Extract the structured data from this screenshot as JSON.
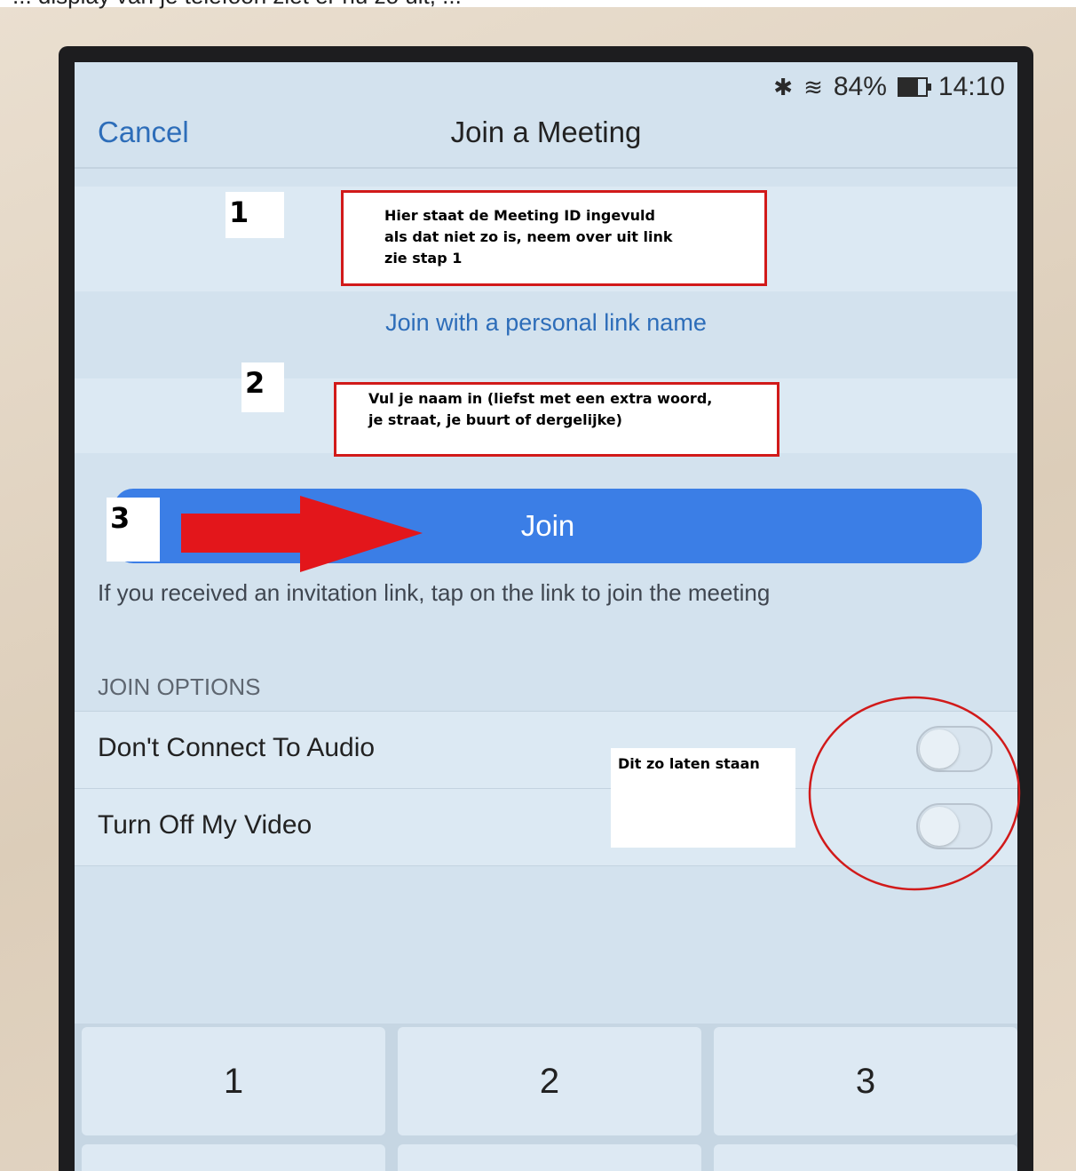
{
  "document_caption": "... display van je telefoon ziet er nu zo uit, ...",
  "status_bar": {
    "bluetooth_icon": "bluetooth-icon",
    "wifi_icon": "wifi-icon",
    "battery": "84%",
    "time": "14:10"
  },
  "nav": {
    "cancel": "Cancel",
    "title": "Join a Meeting"
  },
  "personal_link": "Join with a personal link name",
  "join_button": "Join",
  "invite_hint": "If you received an invitation link, tap on the link to join the meeting",
  "join_options": {
    "header": "JOIN OPTIONS",
    "audio_label": "Don't Connect To Audio",
    "video_label": "Turn Off My Video"
  },
  "keypad": [
    "1",
    "2",
    "3"
  ],
  "annotations": {
    "step1": "1",
    "step2": "2",
    "step3": "3",
    "callout1_lines": [
      "Hier staat de Meeting ID ingevuld",
      "als dat niet zo is, neem over uit link",
      "zie stap 1"
    ],
    "callout2_lines": [
      "Vul je naam in (liefst met een extra woord,",
      "je straat, je buurt of dergelijke)"
    ],
    "note": "Dit zo laten staan",
    "accent_red": "#d11a1a",
    "arrow_red": "#e3161b"
  },
  "colors": {
    "link_blue": "#2d6db9",
    "join_blue": "#3b7ee6"
  }
}
